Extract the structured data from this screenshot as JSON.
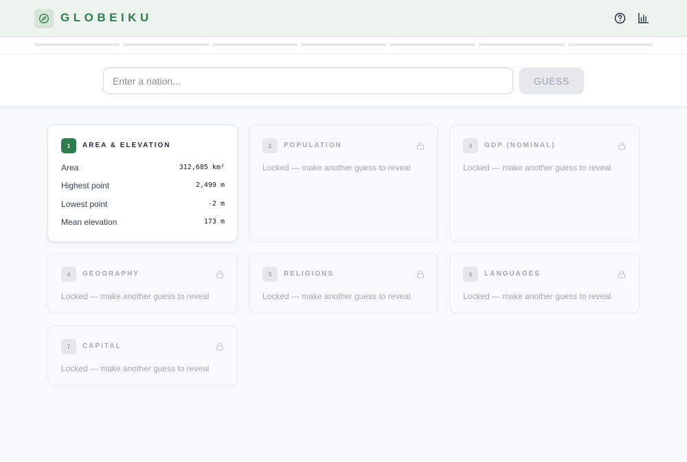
{
  "app": {
    "brand": "GLOBEIKU",
    "logo_icon": "compass-icon",
    "help_icon": "help-circle-icon",
    "stats_icon": "bar-chart-icon",
    "accent_color": "#2e7d4f"
  },
  "progress": {
    "total_segments": 7,
    "filled_segments": 0
  },
  "search": {
    "placeholder": "Enter a nation...",
    "value": "",
    "guess_label": "GUESS"
  },
  "clues": [
    {
      "number": "1",
      "title": "AREA & ELEVATION",
      "state": "revealed",
      "rows": [
        {
          "label": "Area",
          "value": "312,685 km²"
        },
        {
          "label": "Highest point",
          "value": "2,499 m"
        },
        {
          "label": "Lowest point",
          "value": "-2 m"
        },
        {
          "label": "Mean elevation",
          "value": "173 m"
        }
      ]
    },
    {
      "number": "2",
      "title": "POPULATION",
      "state": "locked",
      "message": "Locked — make another guess to reveal"
    },
    {
      "number": "3",
      "title": "GDP (NOMINAL)",
      "state": "locked",
      "message": "Locked — make another guess to reveal"
    },
    {
      "number": "4",
      "title": "GEOGRAPHY",
      "state": "locked",
      "message": "Locked — make another guess to reveal"
    },
    {
      "number": "5",
      "title": "RELIGIONS",
      "state": "locked",
      "message": "Locked — make another guess to reveal"
    },
    {
      "number": "6",
      "title": "LANGUAGES",
      "state": "locked",
      "message": "Locked — make another guess to reveal"
    },
    {
      "number": "7",
      "title": "CAPITAL",
      "state": "locked",
      "message": "Locked — make another guess to reveal"
    }
  ]
}
